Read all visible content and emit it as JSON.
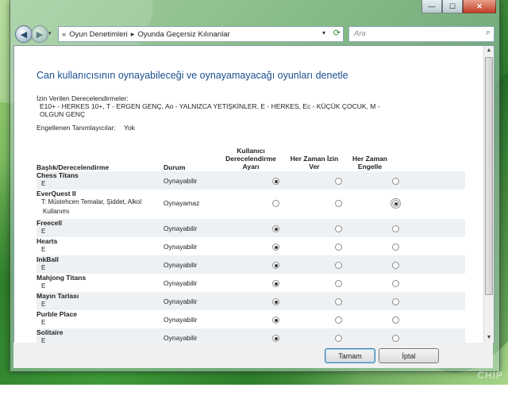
{
  "window": {
    "minimize_glyph": "—",
    "maximize_glyph": "☐",
    "close_glyph": "✕"
  },
  "nav": {
    "back_glyph": "◀",
    "forward_glyph": "▶",
    "history_glyph": "▾",
    "address_root_glyph": "«",
    "breadcrumb": [
      "Oyun Denetimleri",
      "Oyunda Geçersiz Kılınanlar"
    ],
    "separator": "▸",
    "search_placeholder": "Ara",
    "icons": {
      "refresh": "refresh-icon",
      "search": "search-icon"
    }
  },
  "page": {
    "title": "Can kullanıcısının oynayabileceği ve oynayamayacağı oyunları denetle",
    "allowed_label": "İzin Verilen Derecelendirmeler:",
    "allowed_line1": "E10+ - HERKES 10+, T - ERGEN GENÇ, Ao - YALNIZCA YETİŞKİNLER, E - HERKES, Ec - KÜÇÜK ÇOCUK, M -",
    "allowed_line2": "OLGUN GENÇ",
    "blocked_label": "Engellenen Tanımlayıcılar:",
    "blocked_value": "Yok"
  },
  "table": {
    "col_title": "Başlık/Derecelendirme",
    "col_status": "Durum",
    "col_user_rating": [
      "Kullanıcı",
      "Derecelendirme",
      "Ayarı"
    ],
    "col_always_allow": [
      "Her Zaman İzin",
      "Ver"
    ],
    "col_always_block": [
      "Her Zaman",
      "Engelle"
    ],
    "rows": [
      {
        "title": "Chess Titans",
        "rating": "E",
        "status": "Oynayabilir",
        "selected": 0
      },
      {
        "title": "EverQuest II",
        "rating": "T: Müstehcen Temalar, Şiddet, Alkol",
        "rating2": "Kullanımı",
        "status": "Oynayamaz",
        "selected": 2
      },
      {
        "title": "Freecell",
        "rating": "E",
        "status": "Oynayabilir",
        "selected": 0
      },
      {
        "title": "Hearts",
        "rating": "E",
        "status": "Oynayabilir",
        "selected": 0
      },
      {
        "title": "InkBall",
        "rating": "E",
        "status": "Oynayabilir",
        "selected": 0
      },
      {
        "title": "Mahjong Titans",
        "rating": "E",
        "status": "Oynayabilir",
        "selected": 0
      },
      {
        "title": "Mayın Tarlası",
        "rating": "E",
        "status": "Oynayabilir",
        "selected": 0
      },
      {
        "title": "Purble Place",
        "rating": "E",
        "status": "Oynayabilir",
        "selected": 0
      },
      {
        "title": "Solitaire",
        "rating": "E",
        "status": "Oynayabilir",
        "selected": 0
      }
    ]
  },
  "buttons": {
    "ok": "Tamam",
    "cancel": "İptal"
  },
  "scrollbar": {
    "up_glyph": "▲",
    "down_glyph": "▼"
  },
  "watermark": "CHIP"
}
